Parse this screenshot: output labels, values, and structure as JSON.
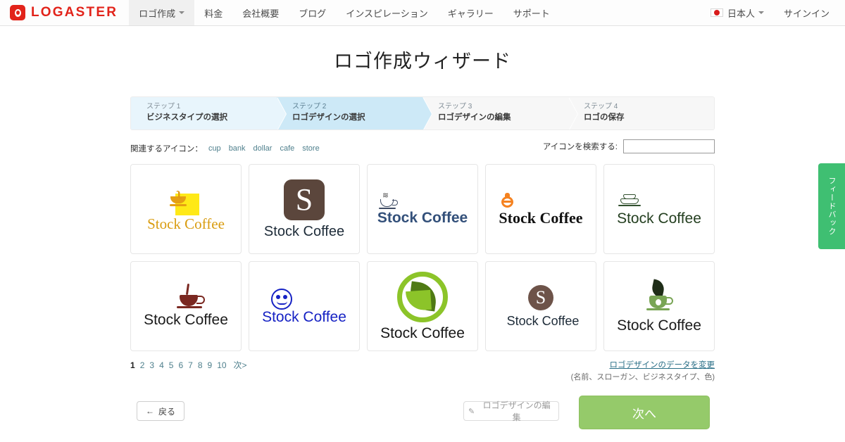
{
  "header": {
    "brand": "LOGASTER",
    "nav": [
      {
        "label": "ロゴ作成",
        "has_caret": true,
        "active": true
      },
      {
        "label": "料金",
        "has_caret": false,
        "active": false
      },
      {
        "label": "会社概要",
        "has_caret": false,
        "active": false
      },
      {
        "label": "ブログ",
        "has_caret": false,
        "active": false
      },
      {
        "label": "インスピレーション",
        "has_caret": false,
        "active": false
      },
      {
        "label": "ギャラリー",
        "has_caret": false,
        "active": false
      },
      {
        "label": "サポート",
        "has_caret": false,
        "active": false
      }
    ],
    "language": "日本人",
    "signin": "サインイン"
  },
  "page_title": "ロゴ作成ウィザード",
  "steps": [
    {
      "num": "ステップ 1",
      "label": "ビジネスタイプの選択",
      "state": "done"
    },
    {
      "num": "ステップ 2",
      "label": "ロゴデザインの選択",
      "state": "current"
    },
    {
      "num": "ステップ 3",
      "label": "ロゴデザインの編集",
      "state": "todo"
    },
    {
      "num": "ステップ 4",
      "label": "ロゴの保存",
      "state": "todo"
    }
  ],
  "related": {
    "label": "関連するアイコン：",
    "tags": [
      "cup",
      "bank",
      "dollar",
      "cafe",
      "store"
    ]
  },
  "search": {
    "label": "アイコンを検索する:",
    "value": "",
    "placeholder": ""
  },
  "logos": [
    {
      "id": "l1",
      "text": "Stock Coffee",
      "icon": "coffee-cup-yellow-square-icon",
      "color": "#d99c10"
    },
    {
      "id": "l2",
      "text": "Stock Coffee",
      "icon": "letter-s-rounded-square-icon",
      "color": "#5b463c"
    },
    {
      "id": "l3",
      "text": "Stock Coffee",
      "icon": "coffee-cup-outline-icon",
      "color": "#33507a"
    },
    {
      "id": "l4",
      "text": "Stock Coffee",
      "icon": "orange-pot-icon",
      "color": "#f58220"
    },
    {
      "id": "l5",
      "text": "Stock Coffee",
      "icon": "layered-cake-icon",
      "color": "#31502e"
    },
    {
      "id": "l6",
      "text": "Stock Coffee",
      "icon": "steaming-cup-icon",
      "color": "#7a2821"
    },
    {
      "id": "l7",
      "text": "Stock Coffee",
      "icon": "smiley-circle-icon",
      "color": "#1622c4"
    },
    {
      "id": "l8",
      "text": "Stock Coffee",
      "icon": "leaf-in-circle-icon",
      "color": "#8cc429"
    },
    {
      "id": "l9",
      "text": "Stock Coffee",
      "icon": "letter-s-circle-icon",
      "color": "#6d5349"
    },
    {
      "id": "l10",
      "text": "Stock Coffee",
      "icon": "green-cup-leaf-icon",
      "color": "#79a555"
    }
  ],
  "pagination": {
    "pages": [
      "1",
      "2",
      "3",
      "4",
      "5",
      "6",
      "7",
      "8",
      "9",
      "10"
    ],
    "active": "1",
    "next": "次>"
  },
  "edit_data": {
    "link": "ロゴデザインのデータを変更",
    "sub": "(名前、スローガン、ビジネスタイプ、色)"
  },
  "buttons": {
    "back": "戻る",
    "back_arrow": "←",
    "edit": "ロゴデザインの編集",
    "edit_icon": "pencil-icon",
    "next": "次へ"
  },
  "feedback_tab": "フィードバック",
  "colors": {
    "brand": "#e2231a",
    "step_current": "#cde9f7",
    "step_done": "#e8f5fc",
    "next_button": "#95ca6a",
    "feedback": "#3fbf72",
    "link": "#4e7f8c"
  }
}
